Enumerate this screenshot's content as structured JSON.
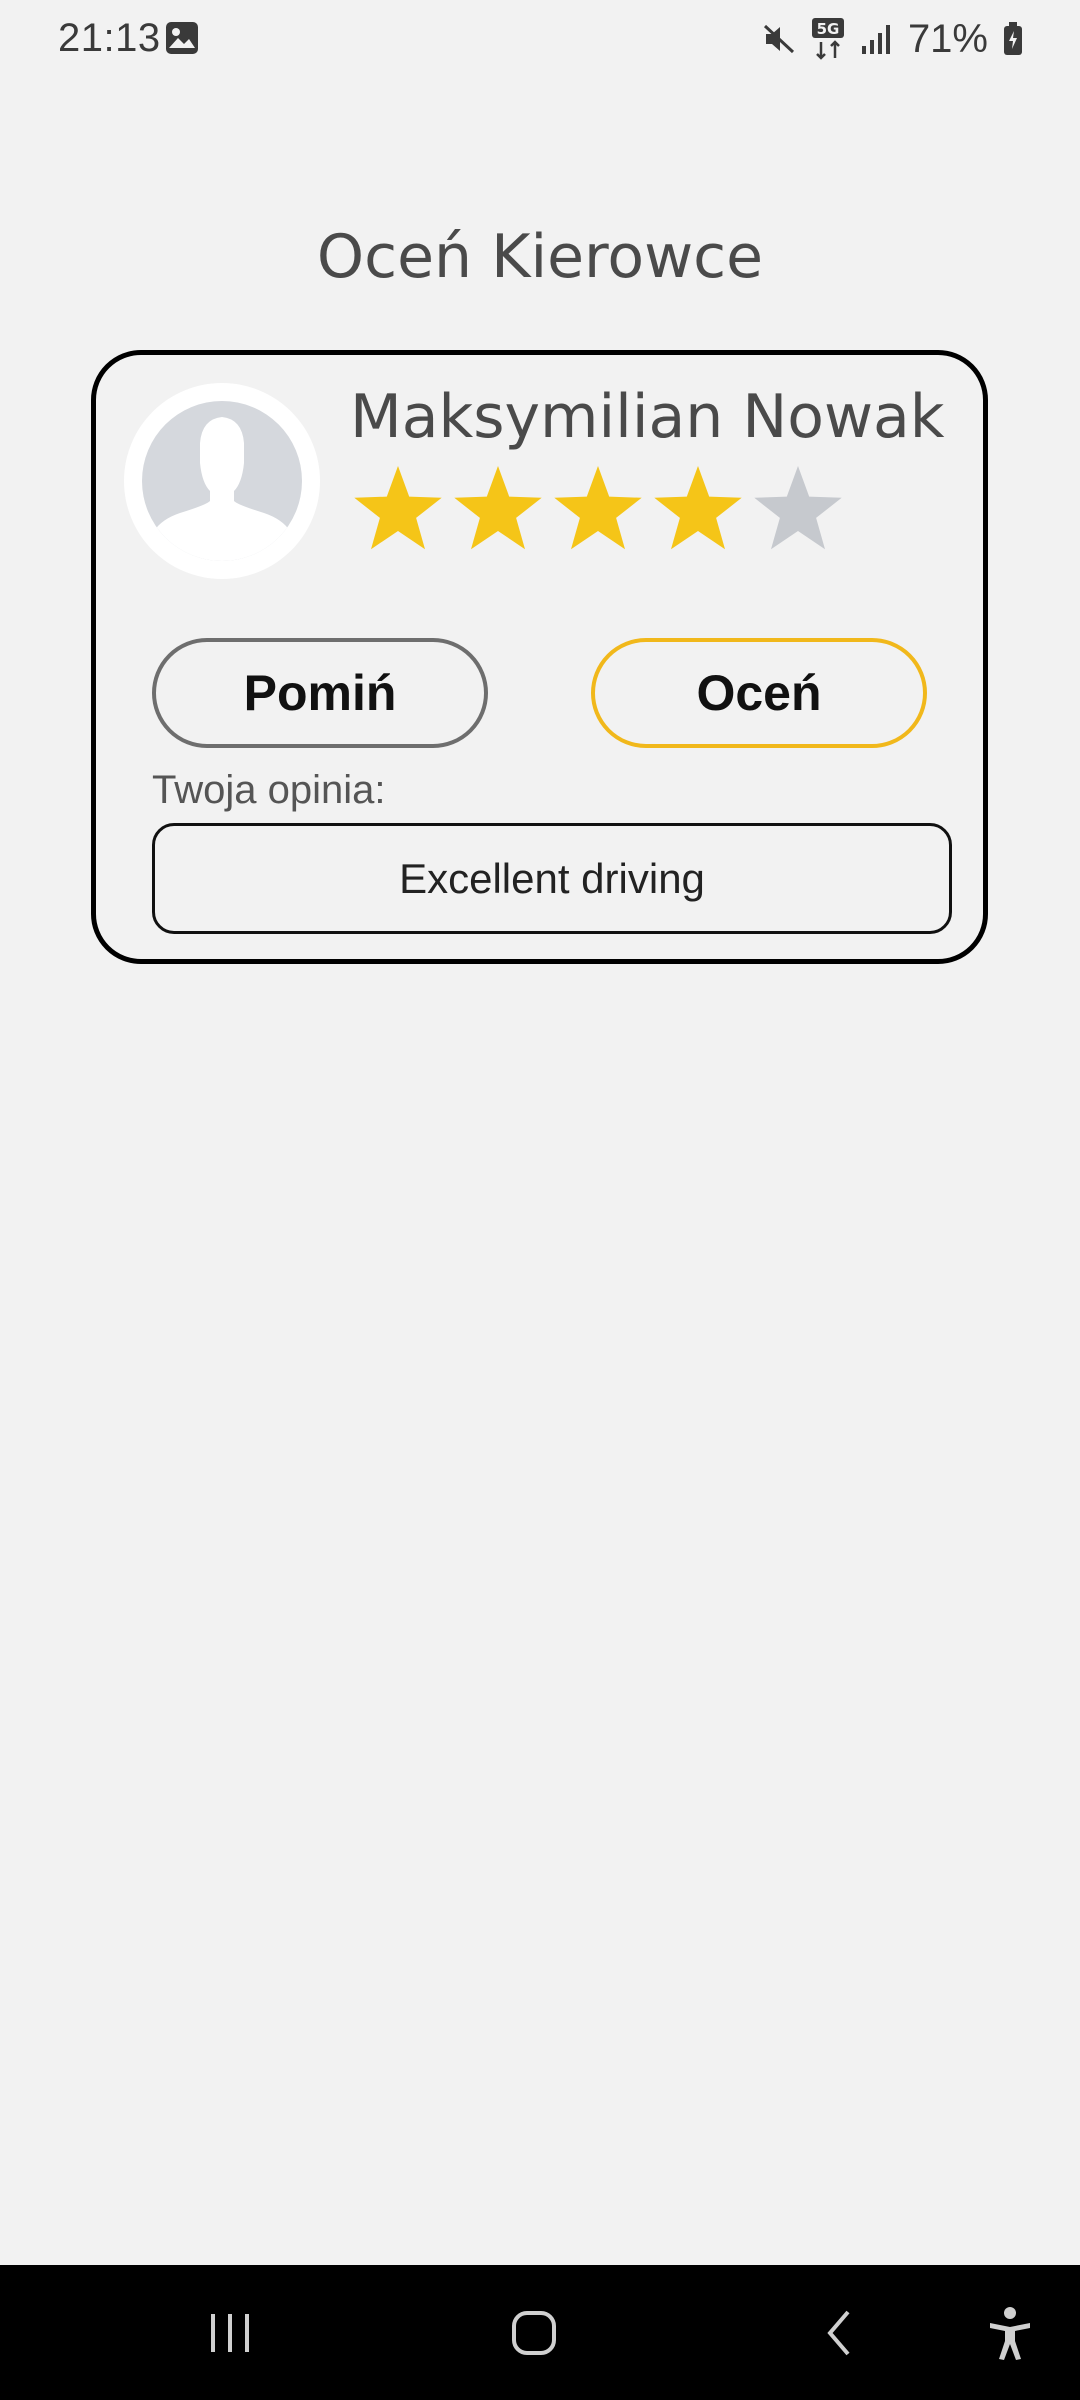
{
  "status_bar": {
    "time": "21:13",
    "battery": "71%",
    "network": "5G",
    "icons": [
      "gallery-icon",
      "mute-icon",
      "5g-icon",
      "signal-icon",
      "battery-icon"
    ]
  },
  "page": {
    "title": "Oceń Kierowce"
  },
  "driver": {
    "name": "Maksymilian Nowak",
    "rating": 4,
    "max_rating": 5,
    "avatar_icon": "person-silhouette-icon"
  },
  "actions": {
    "skip_label": "Pomiń",
    "rate_label": "Oceń"
  },
  "opinion": {
    "label": "Twoja opinia:",
    "value": "Excellent driving"
  },
  "colors": {
    "star_active": "#f5c518",
    "star_inactive": "#c6c9ce",
    "rate_border": "#f1b81b",
    "skip_border": "#6e6e6e"
  },
  "nav_bar": {
    "icons": [
      "recents-icon",
      "home-icon",
      "back-icon",
      "accessibility-icon"
    ]
  }
}
